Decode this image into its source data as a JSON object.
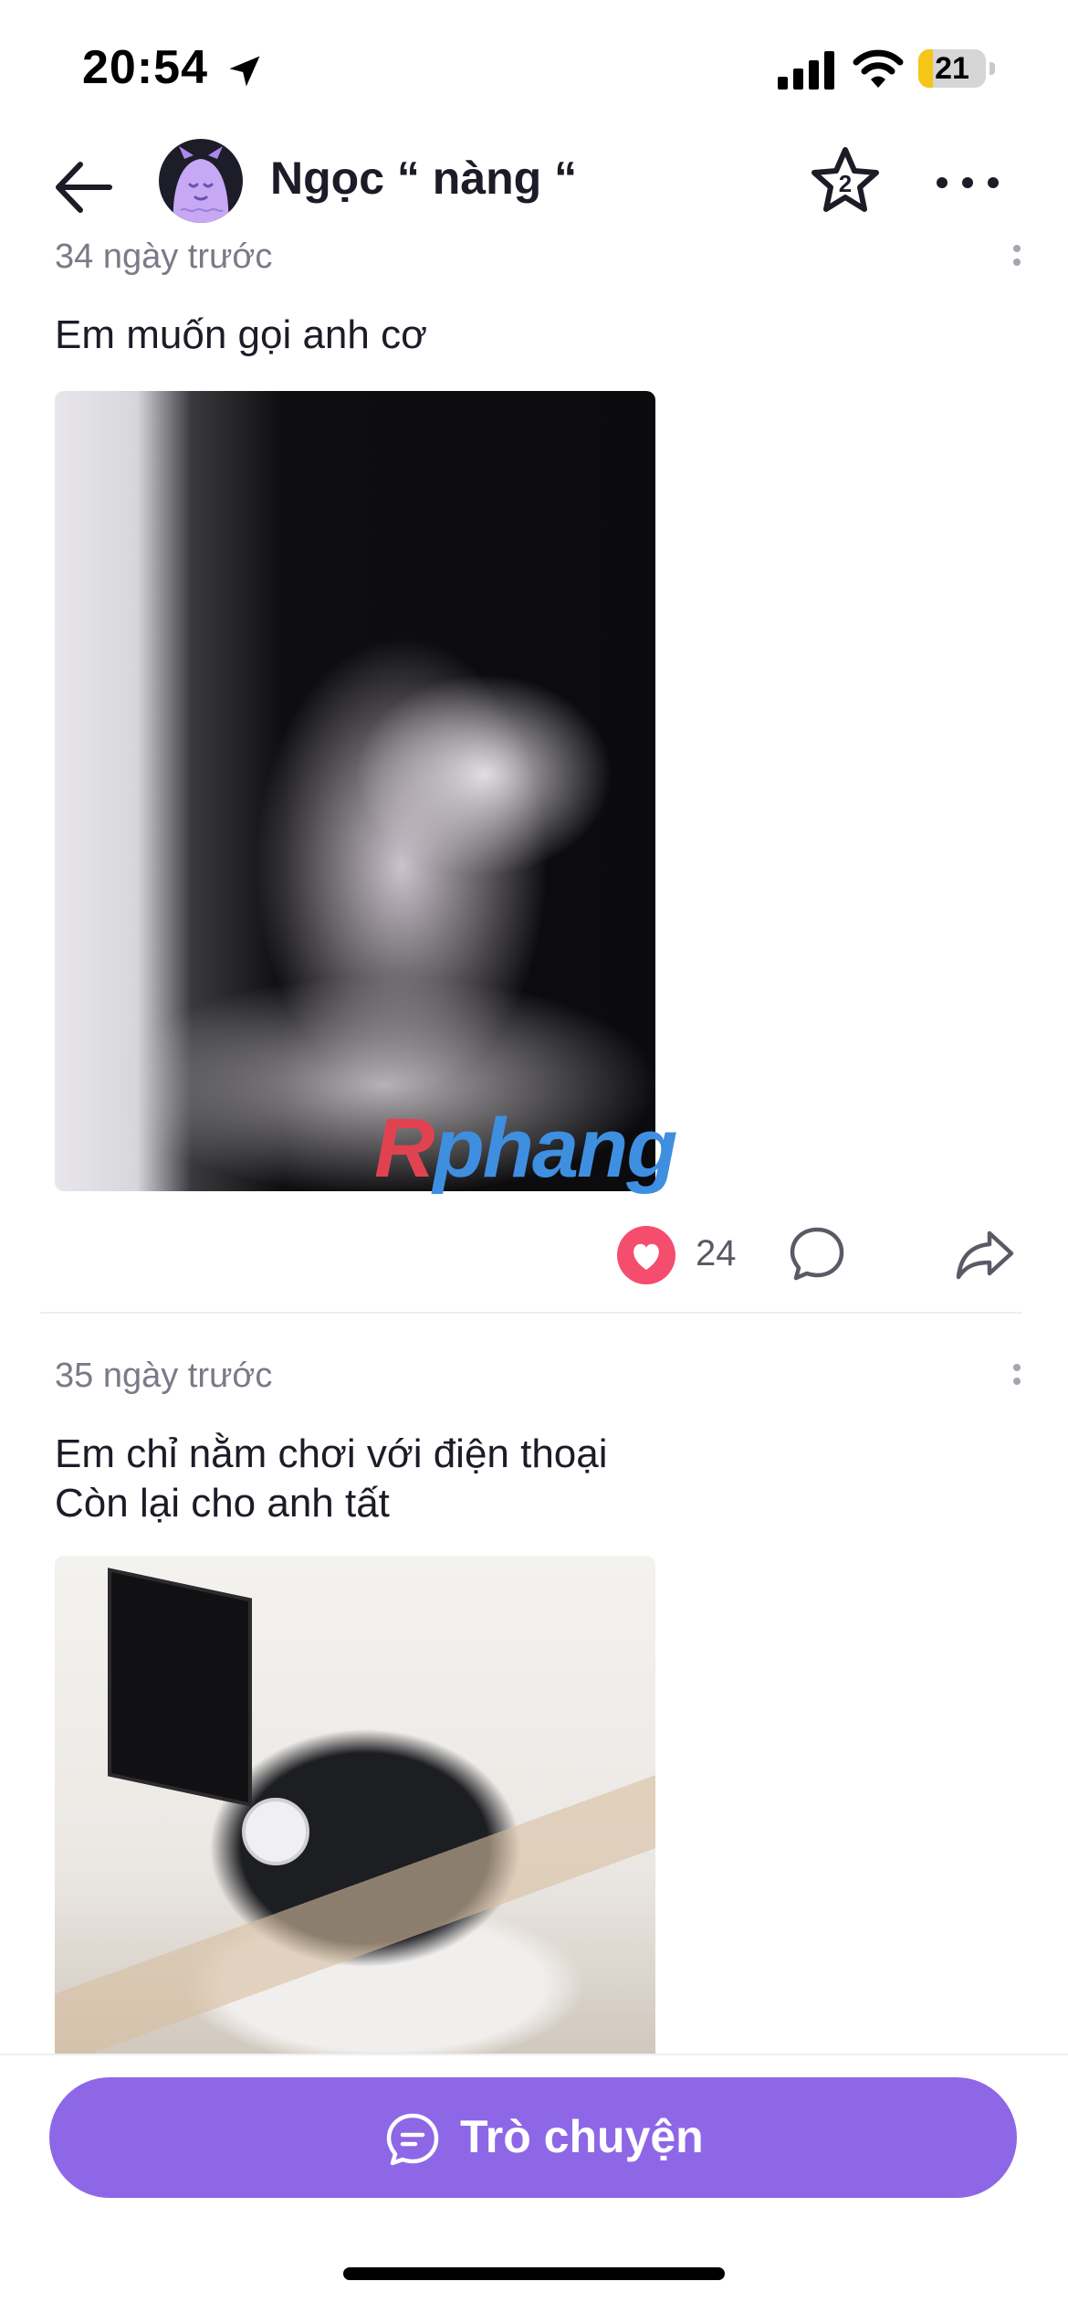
{
  "status_bar": {
    "time": "20:54",
    "battery_level": "21",
    "battery_fraction": 0.21,
    "icons": [
      "location-arrow-icon",
      "cellular-signal-icon",
      "wifi-icon",
      "battery-icon"
    ]
  },
  "header": {
    "user_name": "Ngọc “ nàng “",
    "icons": [
      "back-arrow-icon",
      "avatar",
      "star-badge-icon",
      "more-dots-icon"
    ],
    "star_badge_number": "2"
  },
  "posts": [
    {
      "time": "34 ngày trước",
      "text": "Em muốn gọi anh cơ",
      "likes": "24",
      "liked": true
    },
    {
      "time": "35 ngày trước",
      "text_line1": "Em chỉ nằm chơi với điện thoại",
      "text_line2": "Còn lại cho anh tất"
    }
  ],
  "watermark": {
    "first": "R",
    "rest": "phang"
  },
  "bottom_bar": {
    "chat_label": "Trò chuyện"
  },
  "colors": {
    "accent": "#8e67e6",
    "like": "#f44d6e",
    "text": "#1c1c28",
    "muted": "#7a7a88"
  }
}
